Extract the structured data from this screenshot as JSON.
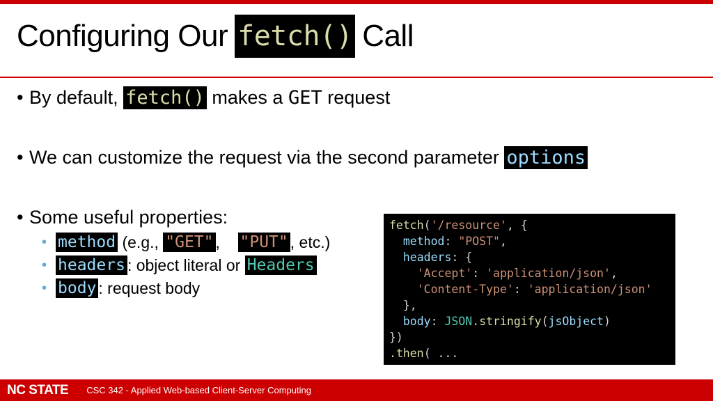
{
  "slide": {
    "title_prefix": "Configuring Our",
    "title_code": "fetch()",
    "title_suffix": "Call"
  },
  "bullets": {
    "b1": {
      "pre": "By default,",
      "code": "fetch()",
      "mid": "makes a",
      "mono": "GET",
      "post": "request"
    },
    "b2": {
      "text": "We can customize the request via the second parameter",
      "code": "options"
    },
    "b3": {
      "text": "Some useful properties:"
    }
  },
  "properties": [
    {
      "name": "method",
      "pre": "(e.g.,",
      "val1": "\"GET\"",
      "sep": ",",
      "val2": "\"PUT\"",
      "post": ", etc.)"
    },
    {
      "name": "headers",
      "text": ": object literal or",
      "cls": "Headers"
    },
    {
      "name": "body",
      "text": ": request body"
    }
  ],
  "code_sample": {
    "l1": {
      "fn": "fetch",
      "p1": "(",
      "s": "'/resource'",
      "p2": ", {"
    },
    "l2": {
      "indent": "  ",
      "k": "method",
      "p": ": ",
      "s": "\"POST\"",
      "e": ","
    },
    "l3": {
      "indent": "  ",
      "k": "headers",
      "p": ": {"
    },
    "l4": {
      "indent": "    ",
      "s1": "'Accept'",
      "p": ": ",
      "s2": "'application/json'",
      "e": ","
    },
    "l5": {
      "indent": "    ",
      "s1": "'Content-Type'",
      "p": ": ",
      "s2": "'application/json'"
    },
    "l6": {
      "text": "  },"
    },
    "l7": {
      "indent": "  ",
      "k": "body",
      "p": ": ",
      "cls": "JSON",
      "dot": ".",
      "fn": "stringify",
      "p2": "(",
      "arg": "jsObject",
      "p3": ")"
    },
    "l8": {
      "text": "})"
    },
    "l9": {
      "p": ".",
      "fn": "then",
      "rest": "( ..."
    }
  },
  "footer": {
    "logo": "NC STATE",
    "course": "CSC 342 - Applied Web-based Client-Server Computing"
  },
  "colors": {
    "brand_red": "#cc0000",
    "code_bg": "#000000"
  }
}
